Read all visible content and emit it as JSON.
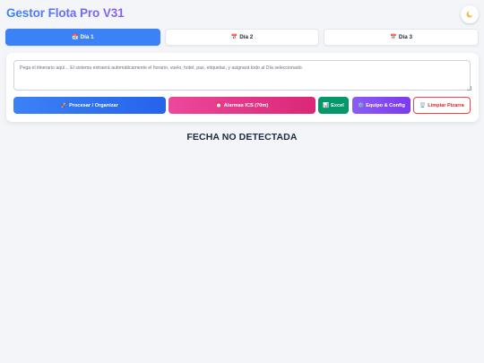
{
  "app": {
    "title": "Gestor Flota Pro V31",
    "theme_icon": "moon-icon"
  },
  "tabs": [
    {
      "label": "Día 1",
      "icon": "calendar-icon",
      "active": true
    },
    {
      "label": "Día 2",
      "icon": "calendar-icon",
      "active": false
    },
    {
      "label": "Día 3",
      "icon": "calendar-icon",
      "active": false
    }
  ],
  "input": {
    "placeholder": "Pega el itinerario aquí... El sistema extraerá automáticamente el horario, vuelo, hotel, pax, etiquetas, y asignará todo al Día seleccionado.",
    "value": ""
  },
  "actions": {
    "process": {
      "label": "Procesar / Organizar",
      "icon": "rocket-icon"
    },
    "alarms": {
      "label": "Alarmas ICS (70m)",
      "icon": "alarm-clock-icon"
    },
    "excel": {
      "label": "Excel",
      "icon": "chart-icon"
    },
    "team": {
      "label": "Equipo & Config",
      "icon": "gear-icon"
    },
    "clear": {
      "label": "Limpiar Pizarra",
      "icon": "trash-icon"
    }
  },
  "status": {
    "message": "FECHA NO DETECTADA"
  },
  "colors": {
    "accent": "#3b82f6",
    "alarm": "#ec4899",
    "excel": "#059669",
    "team": "#8b5cf6",
    "danger": "#ef4444",
    "background": "#f3f5f9"
  }
}
